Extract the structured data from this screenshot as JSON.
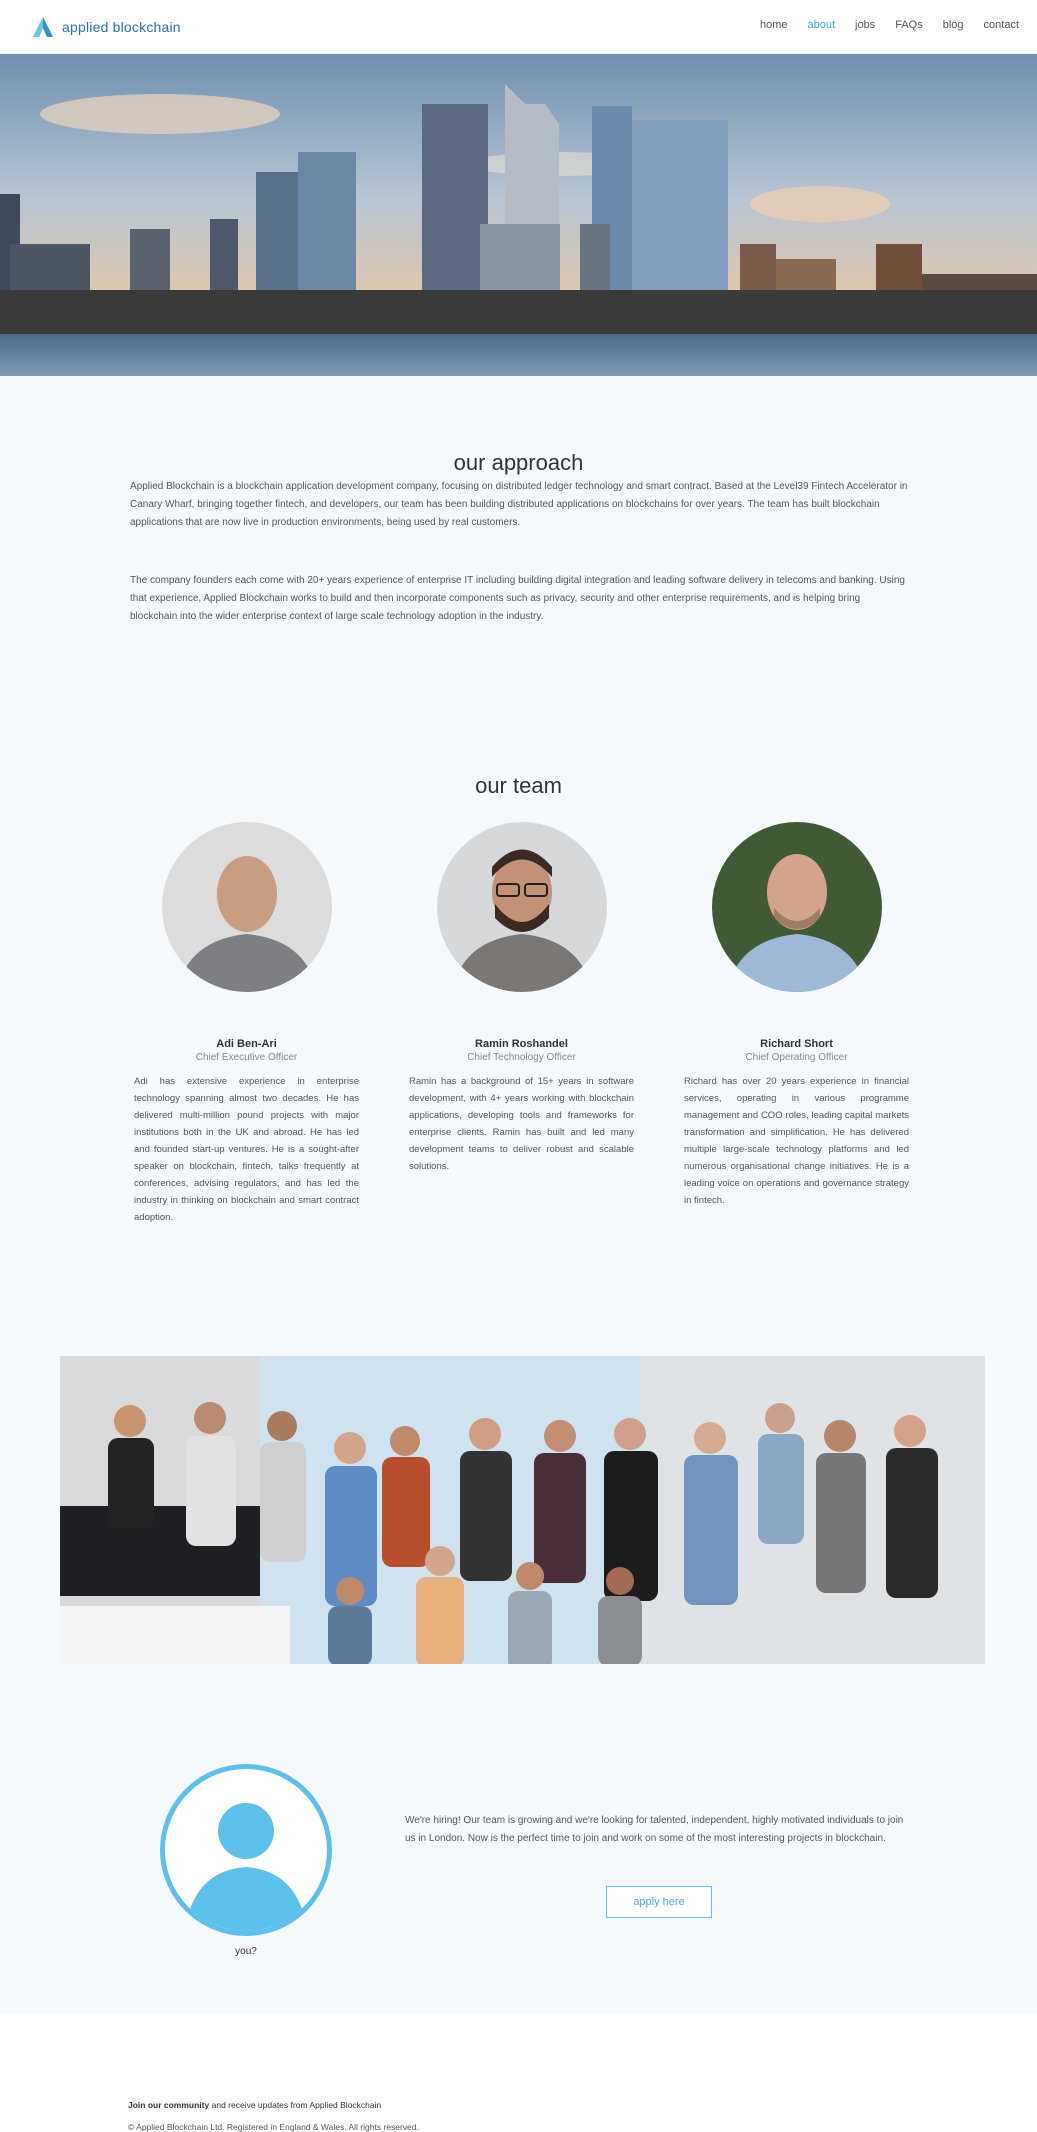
{
  "header": {
    "brand": "applied blockchain",
    "nav": [
      {
        "label": "home",
        "active": false
      },
      {
        "label": "about",
        "active": true
      },
      {
        "label": "jobs",
        "active": false
      },
      {
        "label": "FAQs",
        "active": false
      },
      {
        "label": "blog",
        "active": false
      },
      {
        "label": "contact",
        "active": false
      }
    ]
  },
  "approach": {
    "title": "our approach",
    "p1": "Applied Blockchain is a blockchain application development company, focusing on distributed ledger technology and smart contract. Based at the Level39 Fintech Accelerator in Canary Wharf, bringing together fintech, and developers, our team has been building distributed applications on blockchains for over years. The team has built blockchain applications that are now live in production environments, being used by real customers.",
    "p2": "The company founders each come with 20+ years experience of enterprise IT including building digital integration and leading software delivery in telecoms and banking. Using that experience, Applied Blockchain works to build and then incorporate components such as privacy, security and other enterprise requirements, and is helping bring blockchain into the wider enterprise context of large scale technology adoption in the industry."
  },
  "team": {
    "title": "our team",
    "members": [
      {
        "name": "Adi Ben-Ari",
        "role": "Chief Executive Officer",
        "bio": "Adi has extensive experience in enterprise technology spanning almost two decades. He has delivered multi-million pound projects with major institutions both in the UK and abroad. He has led and founded start-up ventures. He is a sought-after speaker on blockchain, fintech, talks frequently at conferences, advising regulators, and has led the industry in thinking on blockchain and smart contract adoption."
      },
      {
        "name": "Ramin Roshandel",
        "role": "Chief Technology Officer",
        "bio": "Ramin has a background of 15+ years in software development, with 4+ years working with blockchain applications, developing tools and frameworks for enterprise clients. Ramin has built and led many development teams to deliver robust and scalable solutions."
      },
      {
        "name": "Richard Short",
        "role": "Chief Operating Officer",
        "bio": "Richard has over 20 years experience in financial services, operating in various programme management and COO roles, leading capital markets transformation and simplification. He has delivered multiple large-scale technology platforms and led numerous organisational change initiatives. He is a leading voice on operations and governance strategy in fintech."
      }
    ]
  },
  "hiring": {
    "you_label": "you?",
    "text": "We're hiring! Our team is growing and we're looking for talented, independent, highly motivated individuals to join us in London. Now is the perfect time to join and work on some of the most interesting projects in blockchain.",
    "apply_label": "apply here"
  },
  "footer": {
    "line1_bold": "Join our community",
    "line1_rest": "and receive updates from Applied Blockchain",
    "line2": "© Applied Blockchain Ltd. Registered in England & Wales. All rights reserved."
  },
  "colors": {
    "accent": "#3aa6d8",
    "avatar_ring": "#5bc0eb",
    "page_bg": "#f5f9fc"
  }
}
